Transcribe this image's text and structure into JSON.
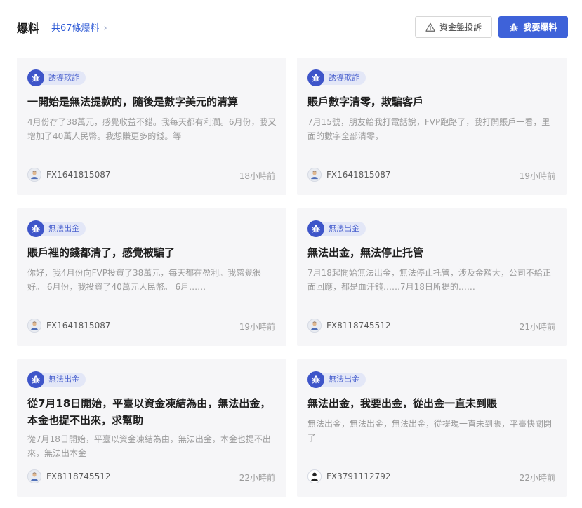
{
  "header": {
    "title": "爆料",
    "count_text": "共67條爆料",
    "complaint_label": "資金盤投訴",
    "report_label": "我要爆料"
  },
  "colors": {
    "primary": "#3e62d9",
    "tag_bg": "#e3e7f7",
    "tag_text": "#4c63cf",
    "card_bg": "#f6f6f8"
  },
  "cards": [
    {
      "tag": "誘導欺詐",
      "title": "一開始是無法提款的，隨後是數字美元的清算",
      "summary": "4月份存了38萬元，感覺收益不錯。我每天都有利潤。6月份，我又增加了40萬人民幣。我想賺更多的錢。等",
      "user": "FX1641815087",
      "time": "18小時前"
    },
    {
      "tag": "誘導欺詐",
      "title": "賬戶數字清零，欺騙客戶",
      "summary": "7月15號，朋友給我打電話說，FVP跑路了，我打開賬戶一看，里面的數字全部清零，",
      "user": "FX1641815087",
      "time": "19小時前"
    },
    {
      "tag": "無法出金",
      "title": "賬戶裡的錢都清了，感覺被騙了",
      "summary": "你好，我4月份向FVP投資了38萬元，每天都在盈利。我感覺很好。 6月份，我投資了40萬元人民幣。 6月……",
      "user": "FX1641815087",
      "time": "19小時前"
    },
    {
      "tag": "無法出金",
      "title": "無法出金，無法停止托管",
      "summary": "7月18起開始無法出金，無法停止托管，涉及金額大，公司不給正面回應，都是血汗錢……7月18日所提的……",
      "user": "FX8118745512",
      "time": "21小時前"
    },
    {
      "tag": "無法出金",
      "title": "從7月18日開始，平臺以資金凍結為由，無法出金，本金也提不出來，求幫助",
      "summary": "從7月18日開始，平臺以資金凍結為由，無法出金，本金也提不出來，無法出本金",
      "user": "FX8118745512",
      "time": "22小時前"
    },
    {
      "tag": "無法出金",
      "title": "無法出金，我要出金，從出金一直未到賬",
      "summary": "無法出金，無法出金，無法出金，從提現一直未到賬，平臺快關閉了",
      "user": "FX3791112792",
      "time": "22小時前"
    }
  ]
}
